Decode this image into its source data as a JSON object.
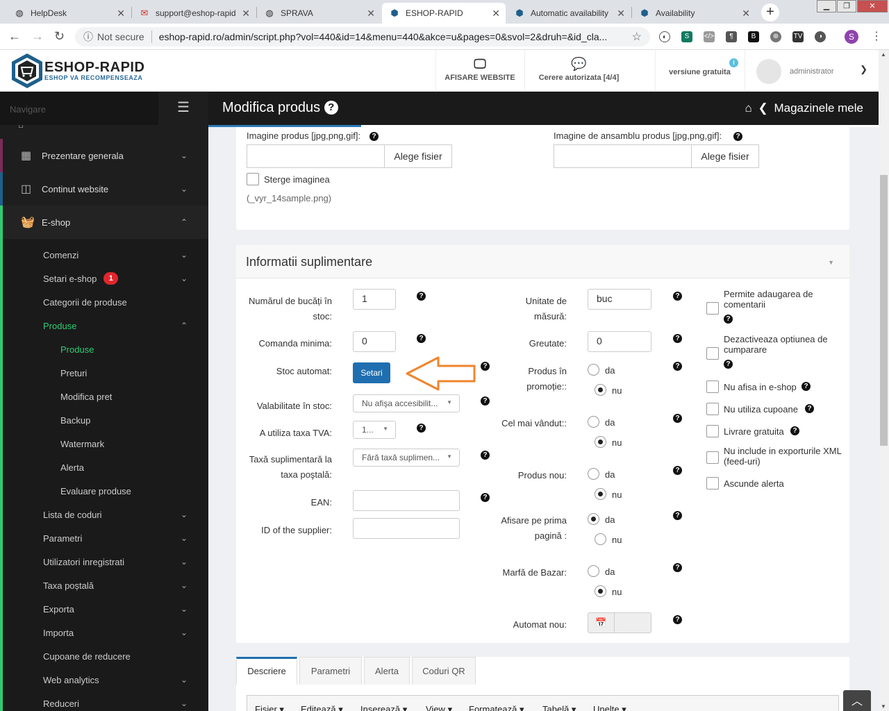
{
  "browser": {
    "tabs": [
      {
        "title": "HelpDesk",
        "icon": "globe-icon"
      },
      {
        "title": "support@eshop-rapid",
        "icon": "gmail-icon"
      },
      {
        "title": "SPRAVA",
        "icon": "globe-icon"
      },
      {
        "title": "ESHOP-RAPID",
        "icon": "eshop-icon"
      },
      {
        "title": "Automatic availability",
        "icon": "eshop-icon"
      },
      {
        "title": "Availability",
        "icon": "eshop-icon"
      }
    ],
    "security_label": "Not secure",
    "url": "eshop-rapid.ro/admin/script.php?vol=440&id=14&menu=440&akce=u&pages=0&svol=2&druh=&id_cla...",
    "profile_initial": "S"
  },
  "header": {
    "logo_title": "ESHOP-RAPID",
    "logo_subtitle": "ESHOP VA RECOMPENSEAZA",
    "btn_website": "AFISARE WEBSITE",
    "btn_requests": "Cerere autorizata [4/4]",
    "version": "versiune gratuita",
    "user": "administrator"
  },
  "sidebar": {
    "nav_label": "Navigare",
    "items": [
      {
        "label": "Prezentare generala"
      },
      {
        "label": "Continut website"
      },
      {
        "label": "E-shop"
      }
    ],
    "sub": [
      {
        "label": "Comenzi"
      },
      {
        "label": "Setari e-shop",
        "badge": "1"
      },
      {
        "label": "Categorii de produse"
      },
      {
        "label": "Produse"
      },
      {
        "label": "Produse"
      },
      {
        "label": "Preturi"
      },
      {
        "label": "Modifica pret"
      },
      {
        "label": "Backup"
      },
      {
        "label": "Watermark"
      },
      {
        "label": "Alerta"
      },
      {
        "label": "Evaluare produse"
      },
      {
        "label": "Lista de coduri"
      },
      {
        "label": "Parametri"
      },
      {
        "label": "Utilizatori inregistrati"
      },
      {
        "label": "Taxa poștală"
      },
      {
        "label": "Exporta"
      },
      {
        "label": "Importa"
      },
      {
        "label": "Cupoane de reducere"
      },
      {
        "label": "Web analytics"
      },
      {
        "label": "Reduceri"
      }
    ]
  },
  "page": {
    "title": "Modifica produs",
    "breadcrumb": "Magazinele mele"
  },
  "images": {
    "product_label": "Imagine produs [jpg,png,gif]:",
    "overview_label": "Imagine de ansamblu produs [jpg,png,gif]:",
    "choose_file": "Alege fisier",
    "delete_label": "Sterge imaginea",
    "filename": "(_vyr_14sample.png)"
  },
  "extra": {
    "title": "Informatii suplimentare",
    "stock_qty_label": "Numărul de bucăți în stoc:",
    "stock_qty": "1",
    "min_order_label": "Comanda minima:",
    "min_order": "0",
    "auto_stock_label": "Stoc automat:",
    "settings_btn": "Setari",
    "validity_label": "Valabilitate în stoc:",
    "validity_value": "Nu afişa accesibilit...",
    "vat_label": "A utiliza taxa TVA:",
    "vat_value": "1...",
    "extra_fee_label": "Taxă suplimentară la taxa poştală:",
    "extra_fee_value": "Fără taxă suplimen...",
    "ean_label": "EAN:",
    "supplier_label": "ID of the supplier:",
    "unit_label": "Unitate de măsură:",
    "unit_value": "buc",
    "weight_label": "Greutate:",
    "weight_value": "0",
    "promo_label": "Produs în promoție::",
    "bestseller_label": "Cel mai vândut::",
    "new_label": "Produs nou:",
    "homepage_label": "Afisare pe prima pagină :",
    "bazaar_label": "Marfă de Bazar:",
    "auto_new_label": "Automat nou:",
    "yes": "da",
    "no": "nu",
    "checks": [
      "Permite adaugarea de comentarii",
      "Dezactiveaza optiunea de cumparare",
      "Nu afisa in e-shop",
      "Nu utiliza cupoane",
      "Livrare gratuita",
      "Nu include in exporturile XML (feed-uri)",
      "Ascunde alerta"
    ]
  },
  "tabs": [
    "Descriere",
    "Parametri",
    "Alerta",
    "Coduri QR"
  ],
  "editor_menu": [
    "Fisier",
    "Editează",
    "Inserează",
    "View",
    "Formatează",
    "Tabelă",
    "Unelte"
  ],
  "colors": {
    "accent": "#1f6fb0",
    "sidebar_active": "#2ecc71",
    "arrow": "#f0852d"
  }
}
